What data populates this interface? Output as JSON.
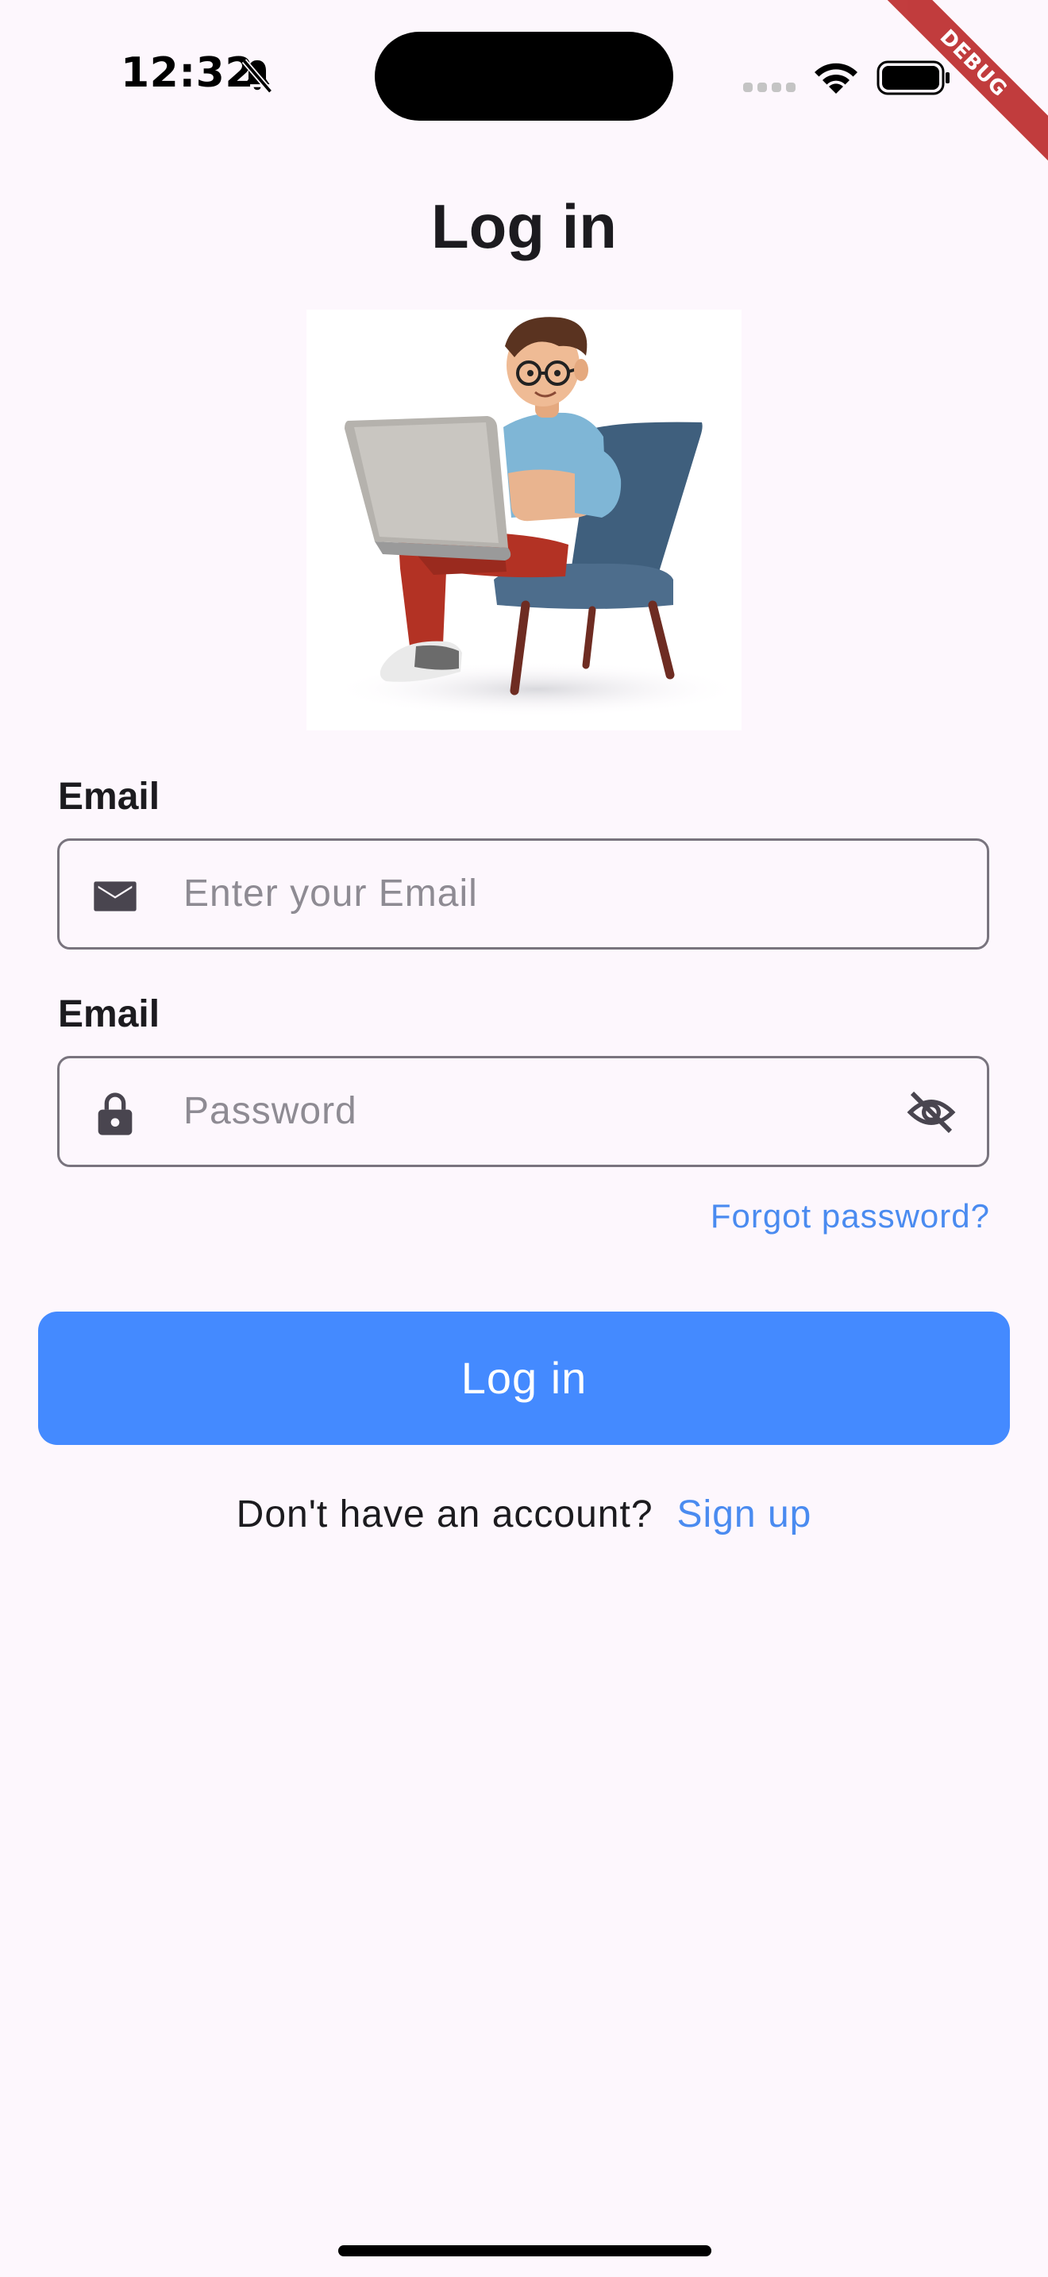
{
  "status_bar": {
    "time": "12:32",
    "icons": [
      "bell-off-icon",
      "signal-icon",
      "wifi-icon",
      "battery-icon"
    ]
  },
  "debug_banner": "DEBUG",
  "page": {
    "title": "Log in"
  },
  "form": {
    "email": {
      "label": "Email",
      "placeholder": "Enter your Email",
      "value": "",
      "icon": "mail-icon"
    },
    "password": {
      "label": "Email",
      "placeholder": "Password",
      "value": "",
      "icon": "lock-icon",
      "toggle_icon": "eye-off-icon"
    },
    "forgot_password": "Forgot password?",
    "submit_label": "Log in"
  },
  "signup": {
    "prompt": "Don't have an account?",
    "link": "Sign up"
  },
  "colors": {
    "background": "#fdf7fd",
    "accent": "#448aff",
    "link": "#4a8bf0",
    "text": "#1c1b1f",
    "placeholder": "#8e8b93",
    "border": "#79747e"
  }
}
